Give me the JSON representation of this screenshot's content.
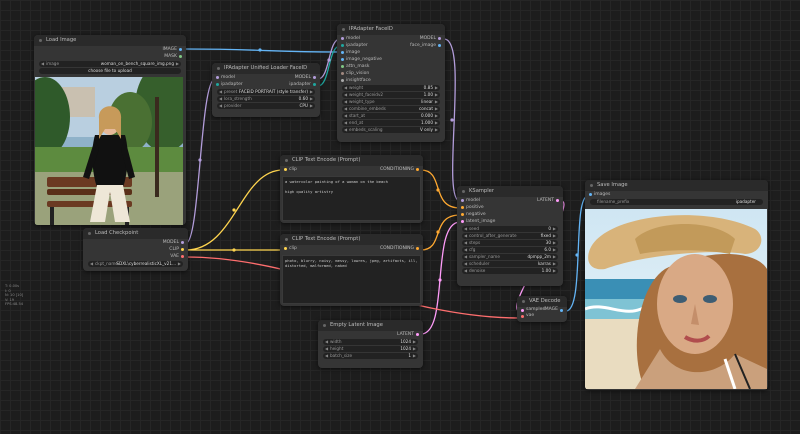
{
  "colors": {
    "image": "#64b5f6",
    "model": "#b39ddb",
    "clip": "#ffd54f",
    "vae": "#ff6e6e",
    "conditioning": "#ffa931",
    "latent": "#ff9cf9",
    "ipadapter": "#1fa7a0",
    "insightface": "#aaaaaa"
  },
  "stats": [
    "T: 0.00s",
    "I: 0",
    "N: 10 [10]",
    "V: 19",
    "FPS:48.54"
  ],
  "load_image": {
    "title": "Load Image",
    "outputs": [
      "IMAGE",
      "MASK"
    ],
    "image_label": "image",
    "image_value": "woman_on_bench_square_img.png",
    "upload_label": "choose file to upload"
  },
  "ipa_loader": {
    "title": "IPAdapter Unified Loader FaceID",
    "inputs": [
      "model",
      "ipadapter"
    ],
    "outputs": [
      "MODEL",
      "ipadapter"
    ],
    "widgets": [
      {
        "label": "preset",
        "value": "FACEID PORTRAIT (style transfer)"
      },
      {
        "label": "lora_strength",
        "value": "0.60"
      },
      {
        "label": "provider",
        "value": "CPU"
      }
    ]
  },
  "ipa_faceid": {
    "title": "IPAdapter FaceID",
    "inputs": [
      "model",
      "ipadapter",
      "image",
      "image_negative",
      "attn_mask",
      "clip_vision",
      "insightface"
    ],
    "outputs": [
      "MODEL",
      "face_image"
    ],
    "widgets": [
      {
        "label": "weight",
        "value": "0.85"
      },
      {
        "label": "weight_faceidv2",
        "value": "1.00"
      },
      {
        "label": "weight_type",
        "value": "linear"
      },
      {
        "label": "combine_embeds",
        "value": "concat"
      },
      {
        "label": "start_at",
        "value": "0.000"
      },
      {
        "label": "end_at",
        "value": "1.000"
      },
      {
        "label": "embeds_scaling",
        "value": "V only"
      }
    ]
  },
  "clip_pos": {
    "title": "CLIP Text Encode (Prompt)",
    "input": "clip",
    "output": "CONDITIONING",
    "text": "a watercolor painting of a woman on the beach\n\nhigh quality artistry"
  },
  "clip_neg": {
    "title": "CLIP Text Encode (Prompt)",
    "input": "clip",
    "output": "CONDITIONING",
    "text": "photo, blurry, noisy, messy, lowres, jpeg, artifacts, ill, distorted, malformed, naked"
  },
  "checkpoint": {
    "title": "Load Checkpoint",
    "outputs": [
      "MODEL",
      "CLIP",
      "VAE"
    ],
    "widget_label": "ckpt_name",
    "widget_value": "SDXL\\cyberrealisticXL_v21..."
  },
  "ksampler": {
    "title": "KSampler",
    "inputs": [
      "model",
      "positive",
      "negative",
      "latent_image"
    ],
    "output": "LATENT",
    "widgets": [
      {
        "label": "seed",
        "value": "0"
      },
      {
        "label": "control_after_generate",
        "value": "fixed"
      },
      {
        "label": "steps",
        "value": "30"
      },
      {
        "label": "cfg",
        "value": "6.0"
      },
      {
        "label": "sampler_name",
        "value": "dpmpp_2m"
      },
      {
        "label": "scheduler",
        "value": "karras"
      },
      {
        "label": "denoise",
        "value": "1.00"
      }
    ]
  },
  "empty_latent": {
    "title": "Empty Latent Image",
    "output": "LATENT",
    "widgets": [
      {
        "label": "width",
        "value": "1024"
      },
      {
        "label": "height",
        "value": "1024"
      },
      {
        "label": "batch_size",
        "value": "1"
      }
    ]
  },
  "vae_decode": {
    "title": "VAE Decode",
    "inputs": [
      "samples",
      "vae"
    ],
    "output": "IMAGE"
  },
  "save_image": {
    "title": "Save Image",
    "input": "images",
    "prefix_label": "filename_prefix",
    "prefix_value": "ipadapter"
  }
}
